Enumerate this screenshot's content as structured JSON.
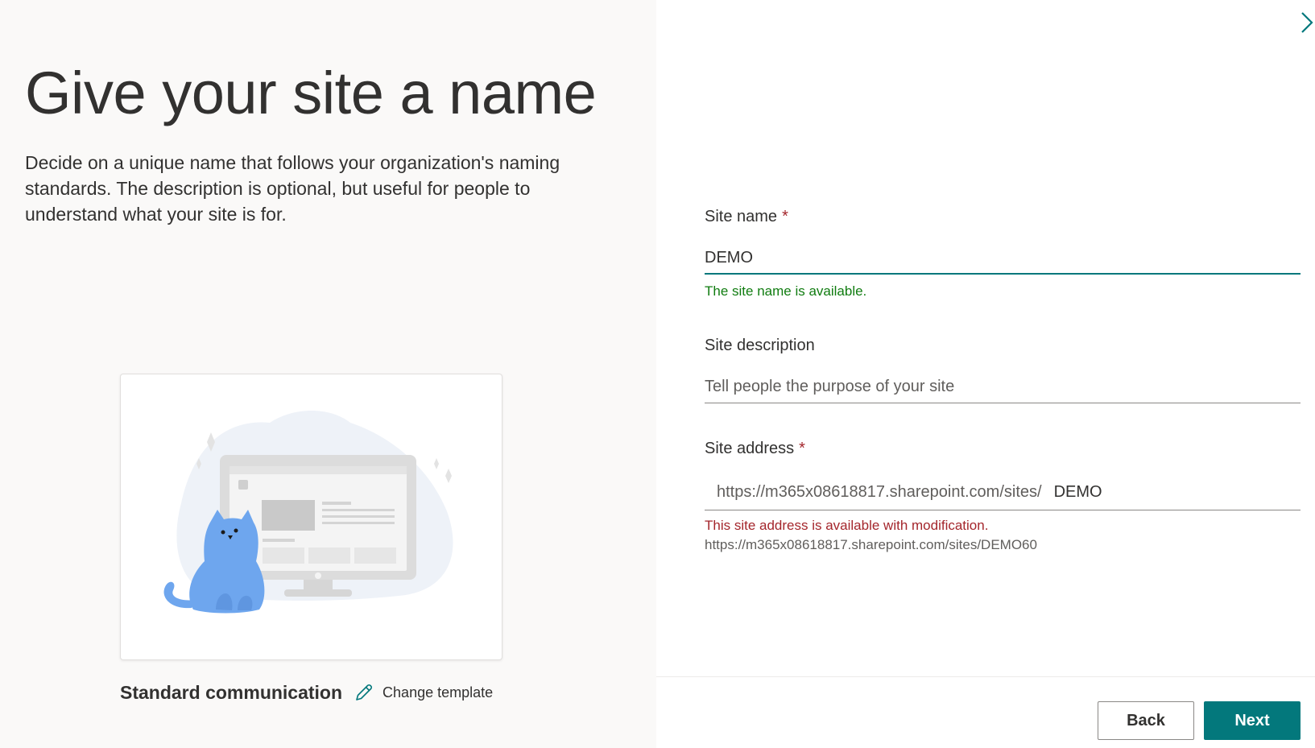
{
  "left": {
    "headline": "Give your site a name",
    "intro": "Decide on a unique name that follows your organization's naming standards. The description is optional, but useful for people to understand what your site is for.",
    "template_name": "Standard communication",
    "change_template_label": "Change template"
  },
  "form": {
    "site_name": {
      "label": "Site name",
      "required_marker": "*",
      "value": "DEMO",
      "status": "The site name is available."
    },
    "site_description": {
      "label": "Site description",
      "placeholder": "Tell people the purpose of your site",
      "value": ""
    },
    "site_address": {
      "label": "Site address",
      "required_marker": "*",
      "prefix": "https://m365x08618817.sharepoint.com/sites/",
      "value": "DEMO",
      "warning": "This site address is available with modification.",
      "suggested_url": "https://m365x08618817.sharepoint.com/sites/DEMO60"
    }
  },
  "footer": {
    "back_label": "Back",
    "next_label": "Next"
  },
  "icons": {
    "close": "chevron-right-icon",
    "change_template": "pencil-icon"
  },
  "colors": {
    "accent": "#03787c",
    "success": "#107c10",
    "error": "#a4262c",
    "left_panel_bg": "#faf9f8",
    "illustration_cat": "#6ea6ee",
    "illustration_blob": "#eef2f8"
  }
}
